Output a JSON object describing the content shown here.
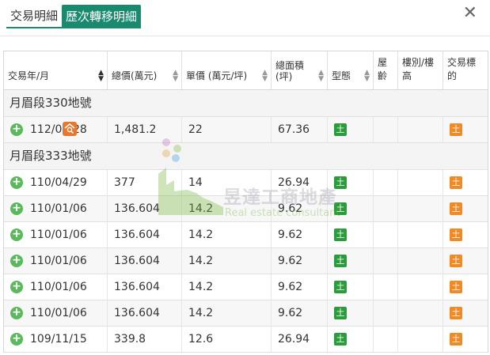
{
  "tabs": [
    {
      "label": "交易明細",
      "active": false
    },
    {
      "label": "歷次轉移明細",
      "active": true
    }
  ],
  "close_icon": "close-icon",
  "columns": [
    {
      "label": "交易年/月",
      "sort": "active"
    },
    {
      "label": "總價(萬元)",
      "sort": "sortable"
    },
    {
      "label": "單價 (萬元/坪)",
      "sort": "sortable"
    },
    {
      "label": "總面積\n(坪)",
      "sort": "sortable"
    },
    {
      "label": "型態",
      "sort": "sortable"
    },
    {
      "label": "屋齡",
      "sort": ""
    },
    {
      "label": "樓別/樓高",
      "sort": ""
    },
    {
      "label": "交易標的",
      "sort": ""
    }
  ],
  "groups": [
    {
      "name": "月眉段330地號",
      "rows": [
        {
          "date": "112/03/28",
          "total": "1,481.2",
          "unit": "22",
          "area": "67.36",
          "type_badge": "土",
          "age": "",
          "floor": "",
          "target_badge": "土",
          "has_search": true
        }
      ]
    },
    {
      "name": "月眉段333地號",
      "rows": [
        {
          "date": "110/04/29",
          "total": "377",
          "unit": "14",
          "area": "26.94",
          "type_badge": "土",
          "age": "",
          "floor": "",
          "target_badge": "土"
        },
        {
          "date": "110/01/06",
          "total": "136.604",
          "unit": "14.2",
          "area": "9.62",
          "type_badge": "土",
          "age": "",
          "floor": "",
          "target_badge": "土"
        },
        {
          "date": "110/01/06",
          "total": "136.604",
          "unit": "14.2",
          "area": "9.62",
          "type_badge": "土",
          "age": "",
          "floor": "",
          "target_badge": "土"
        },
        {
          "date": "110/01/06",
          "total": "136.604",
          "unit": "14.2",
          "area": "9.62",
          "type_badge": "土",
          "age": "",
          "floor": "",
          "target_badge": "土"
        },
        {
          "date": "110/01/06",
          "total": "136.604",
          "unit": "14.2",
          "area": "9.62",
          "type_badge": "土",
          "age": "",
          "floor": "",
          "target_badge": "土"
        },
        {
          "date": "110/01/06",
          "total": "136.604",
          "unit": "14.2",
          "area": "9.62",
          "type_badge": "土",
          "age": "",
          "floor": "",
          "target_badge": "土"
        },
        {
          "date": "109/11/15",
          "total": "339.8",
          "unit": "12.6",
          "area": "26.94",
          "type_badge": "土",
          "age": "",
          "floor": "",
          "target_badge": "土"
        }
      ]
    }
  ],
  "watermark": {
    "name": "昱達工商地產",
    "sub": "Real estate consultant"
  },
  "colors": {
    "accent": "#1a8a6e",
    "plus": "#5cb85c",
    "badge_green": "#2a9c3c",
    "badge_orange": "#f08a24"
  }
}
